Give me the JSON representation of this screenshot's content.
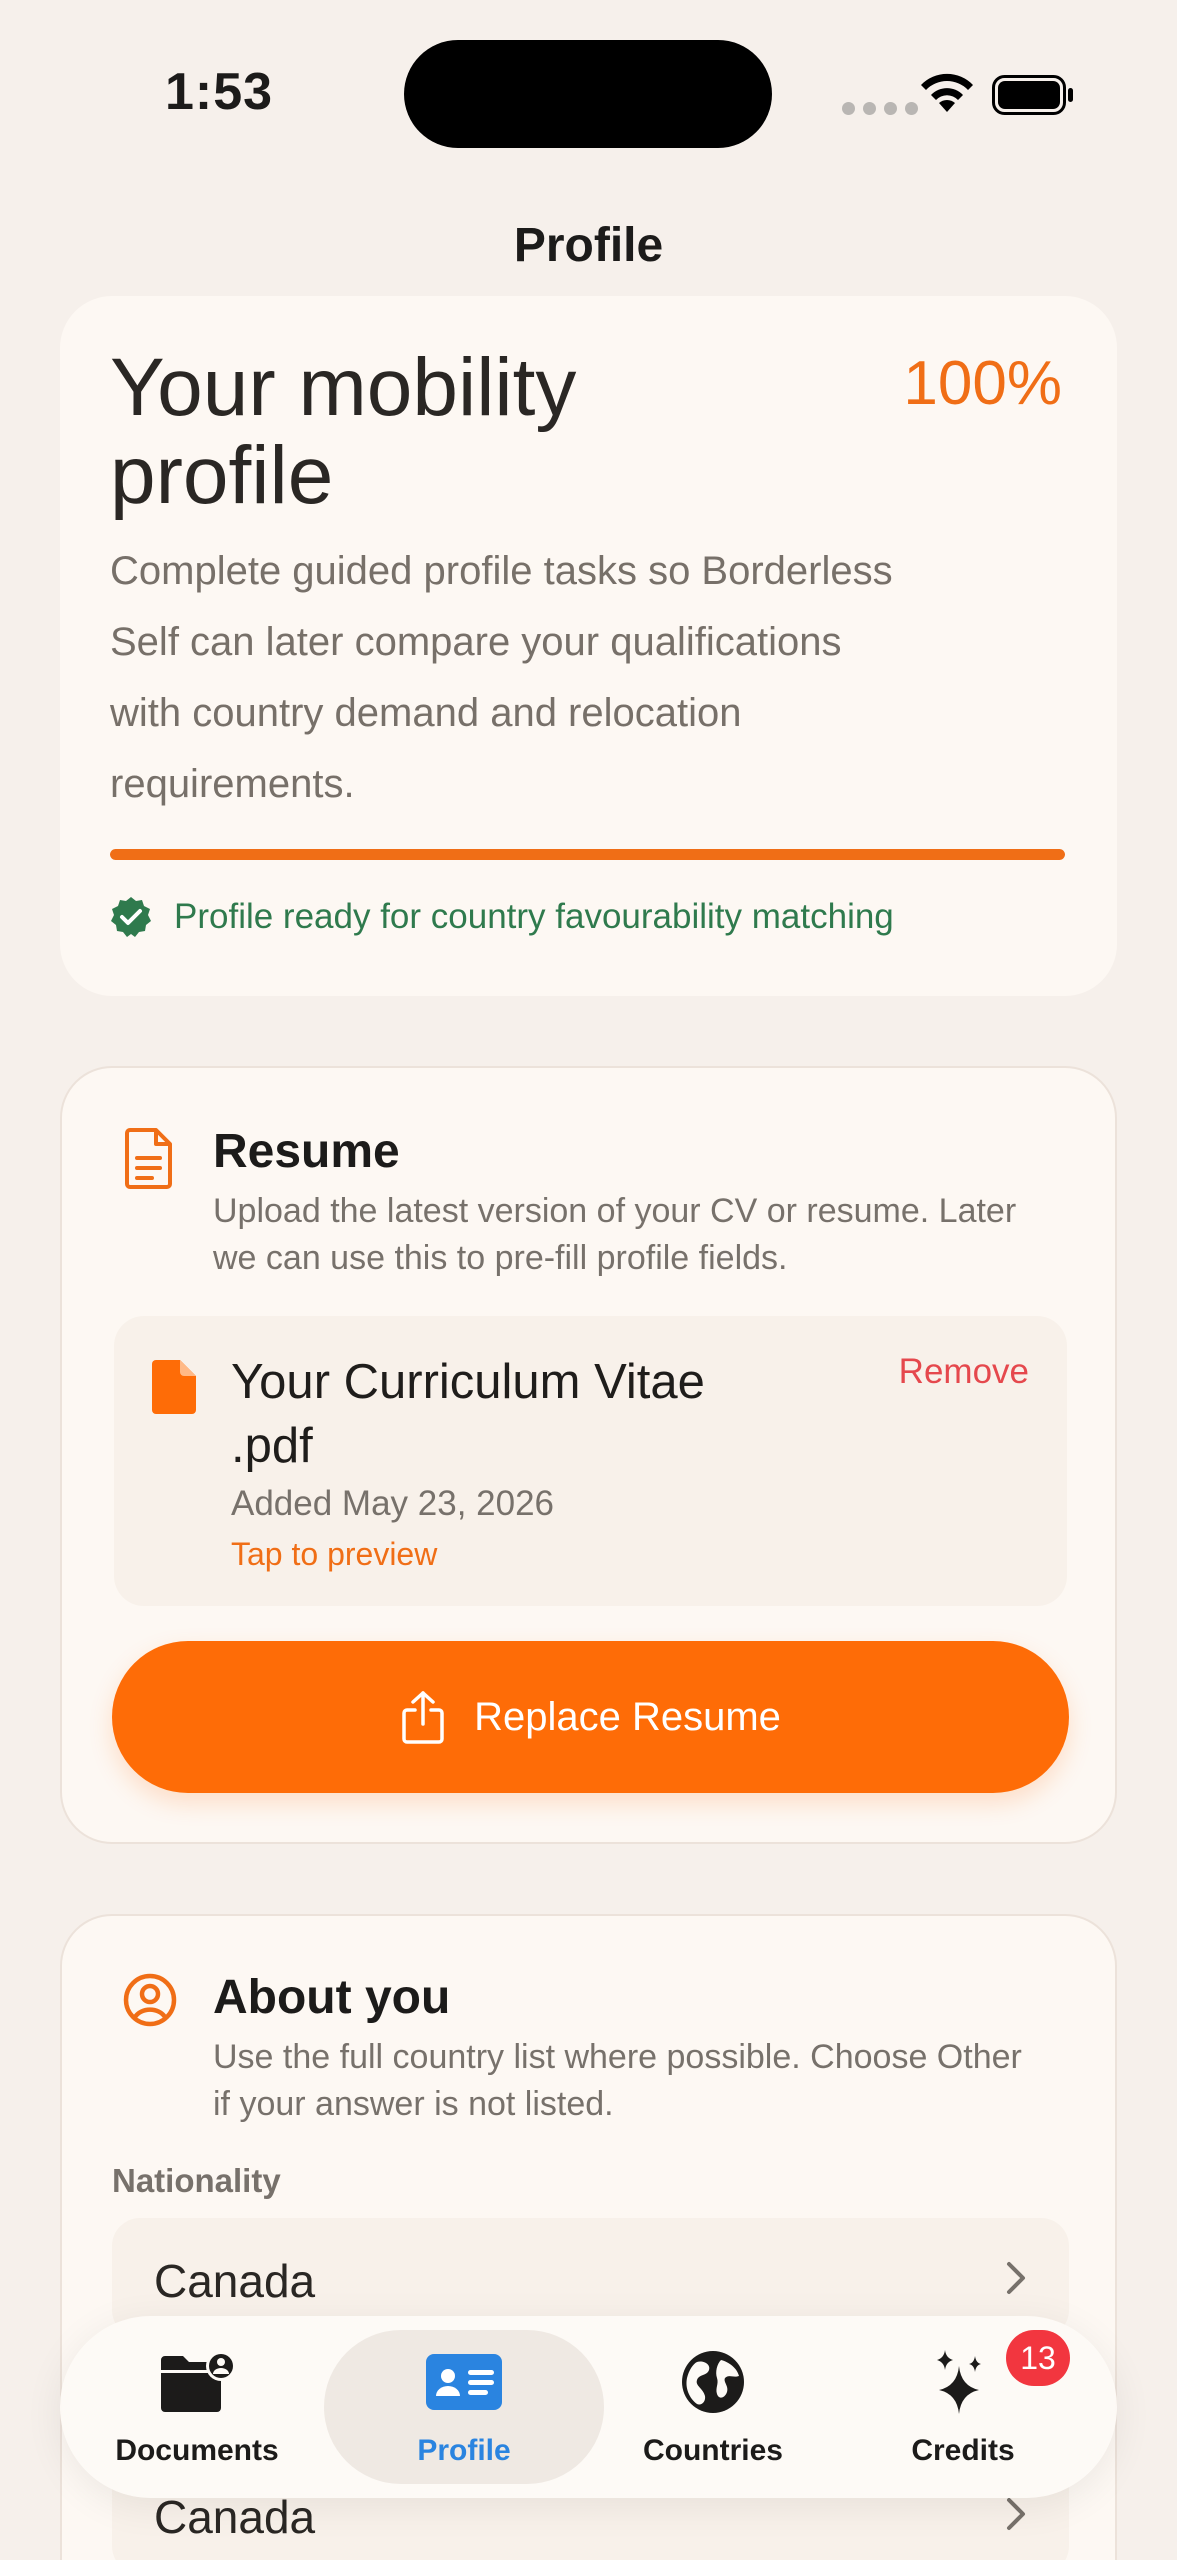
{
  "status_bar": {
    "time": "1:53"
  },
  "nav": {
    "title": "Profile"
  },
  "mobility": {
    "title": "Your mobility profile",
    "percent_label": "100%",
    "progress_fraction": 1.0,
    "description": "Complete guided profile tasks so Borderless Self can later compare your qualifications with country demand and relocation requirements.",
    "ready_text": "Profile ready for country favourability matching"
  },
  "resume": {
    "title": "Resume",
    "description": "Upload the latest version of your CV or resume. Later we can use this to pre-fill profile fields.",
    "file_name": "Your Curriculum Vitae .pdf",
    "file_added": "Added May 23, 2026",
    "file_preview": "Tap to preview",
    "remove_label": "Remove",
    "replace_label": "Replace Resume"
  },
  "about": {
    "title": "About you",
    "description": "Use the full country list where possible. Choose Other if your answer is not listed.",
    "nationality_label": "Nationality",
    "nationality_value": "Canada",
    "second_value": "Canada"
  },
  "tabs": [
    {
      "label": "Documents",
      "icon": "folder-person-icon"
    },
    {
      "label": "Profile",
      "icon": "contact-card-icon"
    },
    {
      "label": "Countries",
      "icon": "globe-icon"
    },
    {
      "label": "Credits",
      "icon": "sparkles-icon",
      "badge": "13"
    }
  ],
  "colors": {
    "accent": "#fe6c07",
    "success": "#2f7a4d",
    "danger": "#e5484d",
    "active_tab": "#2a84e0",
    "background": "#f6f0eb"
  }
}
